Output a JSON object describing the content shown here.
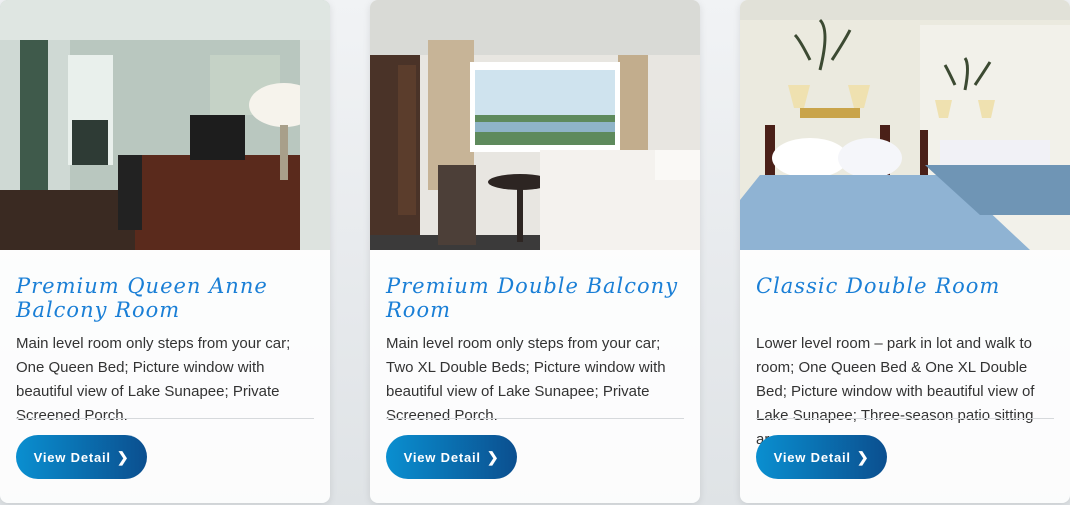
{
  "rooms": [
    {
      "title": "Premium Queen Anne Balcony Room",
      "description": "Main level room only steps from your car; One Queen Bed; Picture window with beautiful view of Lake Sunapee; Private Screened Porch.",
      "button_label": "View Detail",
      "button_icon": "chevron-right-icon"
    },
    {
      "title": "Premium Double Balcony Room",
      "description": "Main level room only steps from your car; Two XL Double Beds; Picture window with beautiful view of Lake Sunapee; Private Screened Porch.",
      "button_label": "View Detail",
      "button_icon": "chevron-right-icon"
    },
    {
      "title": "Classic Double Room",
      "description": "Lower level room – park in lot and walk to room; One Queen Bed & One XL Double Bed; Picture window with beautiful view of Lake Sunapee; Three-season patio sitting area.",
      "button_label": "View Detail",
      "button_icon": "chevron-right-icon"
    }
  ],
  "colors": {
    "title": "#1a7fd6",
    "button_start": "#0a8fd0",
    "button_end": "#0b4f8f"
  }
}
